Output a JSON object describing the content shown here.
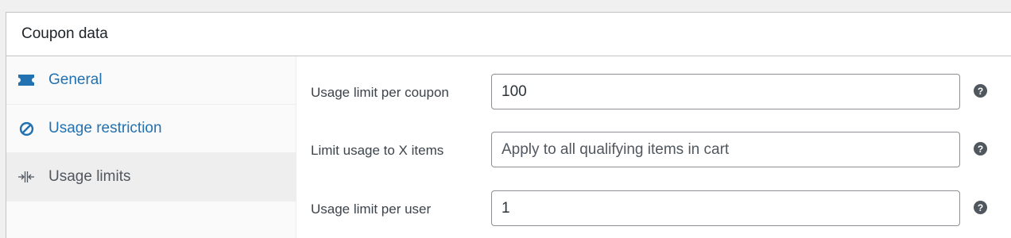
{
  "panel": {
    "title": "Coupon data"
  },
  "tabs": [
    {
      "label": "General",
      "icon": "ticket-icon",
      "active": false
    },
    {
      "label": "Usage restriction",
      "icon": "restricted-icon",
      "active": false
    },
    {
      "label": "Usage limits",
      "icon": "limits-icon",
      "active": true
    }
  ],
  "fields": [
    {
      "label": "Usage limit per coupon",
      "value": "100",
      "placeholder": ""
    },
    {
      "label": "Limit usage to X items",
      "value": "",
      "placeholder": "Apply to all qualifying items in cart"
    },
    {
      "label": "Usage limit per user",
      "value": "1",
      "placeholder": ""
    }
  ],
  "help_glyph": "?",
  "colors": {
    "link": "#2271b1",
    "active_tab_bg": "#eeeeee",
    "border": "#c3c4c7"
  }
}
